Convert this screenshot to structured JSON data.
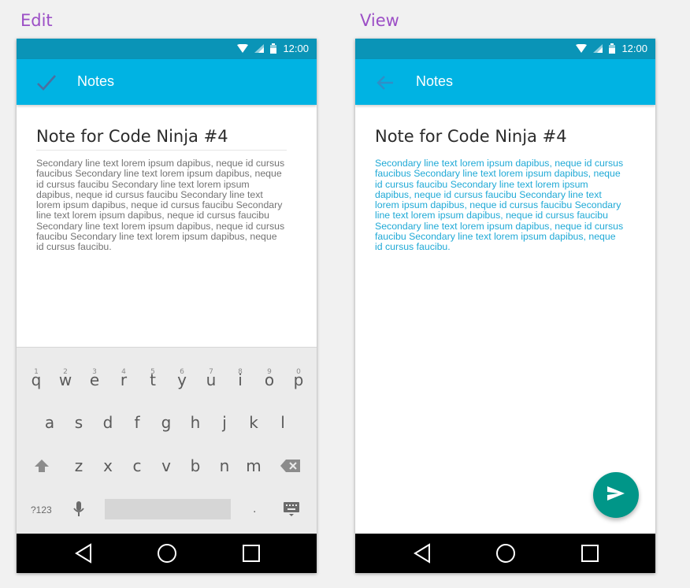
{
  "edit": {
    "caption": "Edit",
    "status_time": "12:00",
    "app_title": "Notes",
    "note_title": "Note for Code Ninja #4",
    "note_body": "Secondary line text lorem ipsum dapibus, neque id cursus faucibus Secondary line text lorem ipsum dapibus, neque id cursus faucibu Secondary line text lorem ipsum dapibus, neque id cursus faucibu Secondary line text lorem ipsum dapibus, neque id cursus faucibu Secondary line text lorem ipsum dapibus, neque id cursus faucibu Secondary line text lorem ipsum dapibus, neque id cursus faucibu Secondary line text lorem ipsum dapibus, neque id cursus faucibu.",
    "keyboard": {
      "row1": [
        {
          "k": "q",
          "n": "1"
        },
        {
          "k": "w",
          "n": "2"
        },
        {
          "k": "e",
          "n": "3"
        },
        {
          "k": "r",
          "n": "4"
        },
        {
          "k": "t",
          "n": "5"
        },
        {
          "k": "y",
          "n": "6"
        },
        {
          "k": "u",
          "n": "7"
        },
        {
          "k": "i",
          "n": "8"
        },
        {
          "k": "o",
          "n": "9"
        },
        {
          "k": "p",
          "n": "0"
        }
      ],
      "row2": [
        "a",
        "s",
        "d",
        "f",
        "g",
        "h",
        "j",
        "k",
        "l"
      ],
      "row3": [
        "z",
        "x",
        "c",
        "v",
        "b",
        "n",
        "m"
      ],
      "symbols_label": "?123",
      "period_label": "."
    }
  },
  "view": {
    "caption": "View",
    "status_time": "12:00",
    "app_title": "Notes",
    "note_title": "Note for Code Ninja #4",
    "note_body": "Secondary line text lorem ipsum dapibus, neque id cursus faucibus Secondary line text lorem ipsum dapibus, neque id cursus faucibu Secondary line text lorem ipsum dapibus, neque id cursus faucibu Secondary line text lorem ipsum dapibus, neque id cursus faucibu Secondary line text lorem ipsum dapibus, neque id cursus faucibu Secondary line text lorem ipsum dapibus, neque id cursus faucibu Secondary line text lorem ipsum dapibus, neque id cursus faucibu."
  },
  "icons": {
    "edit_nav": "check-icon",
    "view_nav": "back-arrow-icon",
    "fab": "send-icon",
    "status": [
      "wifi-icon",
      "signal-icon",
      "battery-icon"
    ],
    "navbar": [
      "back-triangle-icon",
      "home-circle-icon",
      "recents-square-icon"
    ],
    "keyboard": [
      "shift-icon",
      "backspace-icon",
      "mic-icon",
      "emoji-keyboard-icon"
    ]
  },
  "colors": {
    "status_bar": "#0a94b7",
    "app_bar": "#00b3e3",
    "fab": "#009688",
    "caption": "#9c4fc6",
    "link_text": "#1fa9d6"
  }
}
